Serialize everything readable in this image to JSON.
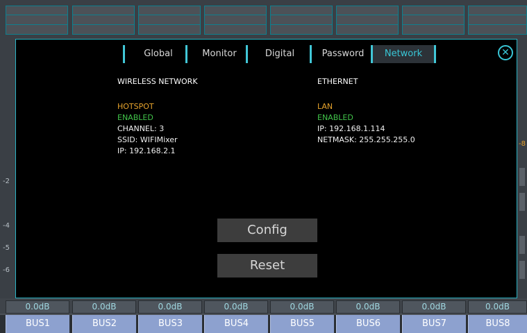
{
  "bus_labels": [
    "BUS1",
    "BUS2",
    "BUS3",
    "BUS4",
    "BUS5",
    "BUS6",
    "BUS7",
    "BUS8"
  ],
  "db_values": [
    "0.0dB",
    "0.0dB",
    "0.0dB",
    "0.0dB",
    "0.0dB",
    "0.0dB",
    "0.0dB",
    "0.0dB"
  ],
  "side_scale": [
    "-2",
    "-4",
    "-5",
    "-6"
  ],
  "right_edge_mark": "-8",
  "tabs": [
    {
      "label": "Global"
    },
    {
      "label": "Monitor"
    },
    {
      "label": "Digital"
    },
    {
      "label": "Password"
    },
    {
      "label": "Network"
    }
  ],
  "close_icon": "✕",
  "wireless": {
    "title": "WIRELESS NETWORK",
    "mode": "HOTSPOT",
    "status": "ENABLED",
    "channel": "CHANNEL: 3",
    "ssid": "SSID: WIFIMixer",
    "ip": "IP: 192.168.2.1"
  },
  "ethernet": {
    "title": "ETHERNET",
    "mode": "LAN",
    "status": "ENABLED",
    "ip": "IP: 192.168.1.114",
    "netmask": "NETMASK: 255.255.255.0"
  },
  "buttons": {
    "config": "Config",
    "reset": "Reset"
  },
  "colors": {
    "accent": "#39c6d6",
    "mode": "#e6a32c",
    "enabled": "#41c44a",
    "bus": "#8da1cf"
  }
}
